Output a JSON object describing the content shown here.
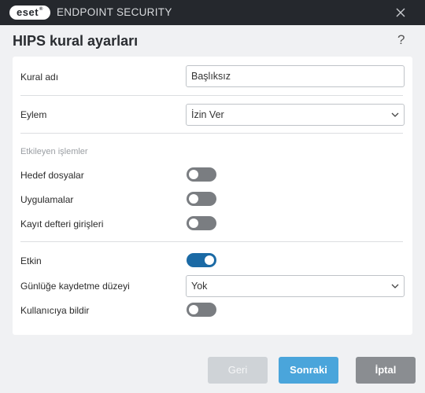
{
  "window": {
    "logo_text": "eset",
    "title": "ENDPOINT SECURITY"
  },
  "dialog": {
    "title": "HIPS kural ayarları",
    "help": "?"
  },
  "form": {
    "rule_name_label": "Kural adı",
    "rule_name_value": "Başlıksız",
    "action_label": "Eylem",
    "action_value": "İzin Ver",
    "affected_section": "Etkileyen işlemler",
    "target_files_label": "Hedef dosyalar",
    "target_files_on": false,
    "applications_label": "Uygulamalar",
    "applications_on": false,
    "registry_label": "Kayıt defteri girişleri",
    "registry_on": false,
    "enabled_label": "Etkin",
    "enabled_on": true,
    "log_level_label": "Günlüğe kaydetme düzeyi",
    "log_level_value": "Yok",
    "notify_user_label": "Kullanıcıya bildir",
    "notify_user_on": false
  },
  "buttons": {
    "back": "Geri",
    "next": "Sonraki",
    "cancel": "İptal"
  }
}
